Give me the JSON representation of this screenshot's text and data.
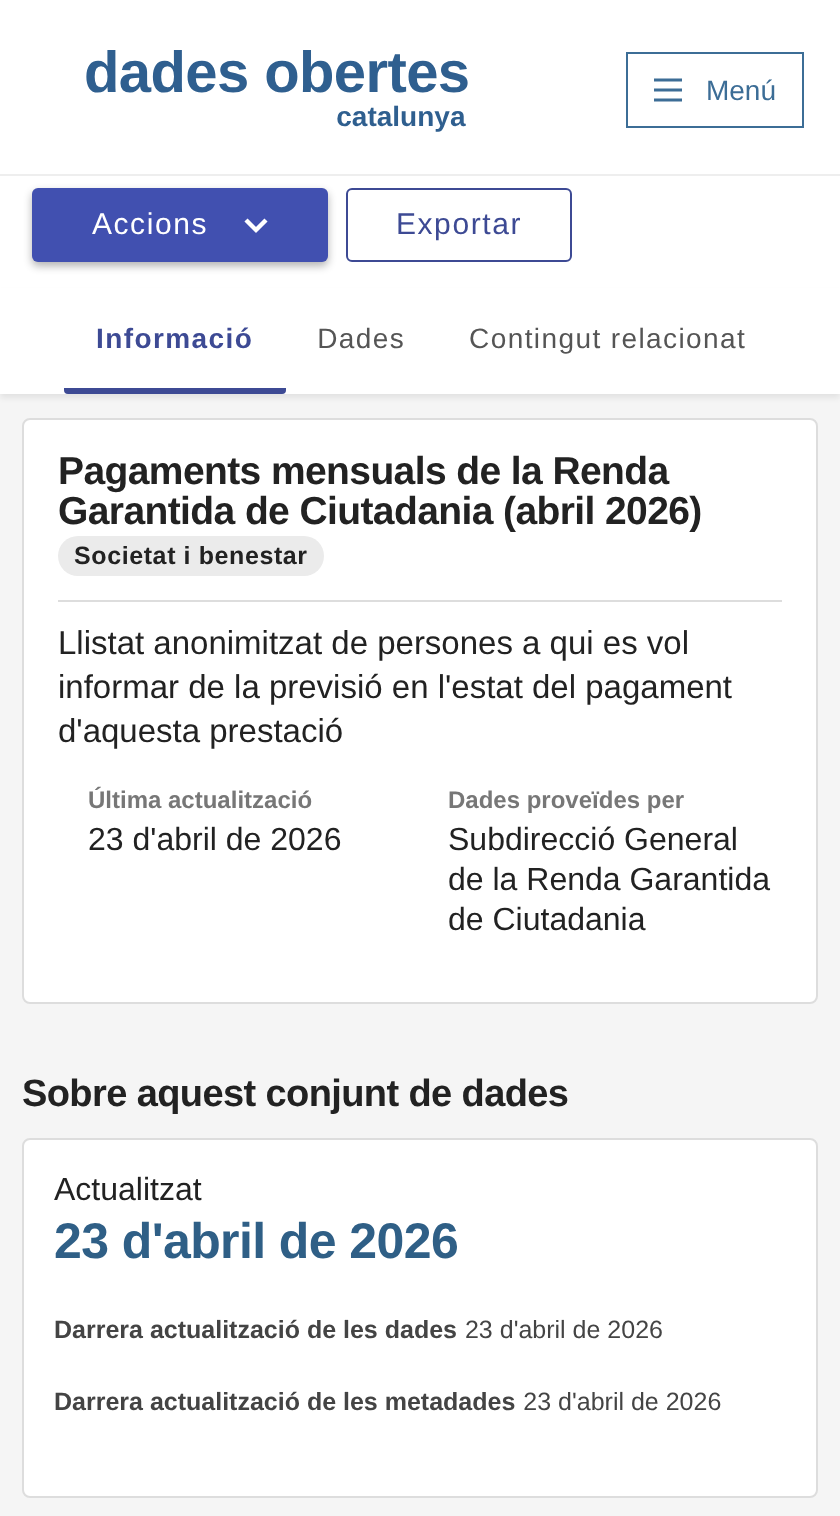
{
  "header": {
    "logo_title": "dades obertes",
    "logo_subtitle": "catalunya",
    "menu_button": "Menú"
  },
  "actions": {
    "primary": "Accions",
    "secondary": "Exportar"
  },
  "tabs": [
    {
      "label": "Informació",
      "selected": true
    },
    {
      "label": "Dades",
      "selected": false
    },
    {
      "label": "Contingut relacionat",
      "selected": false
    }
  ],
  "dataset": {
    "title": "Pagaments mensuals de la Renda Garantida de Ciutadania (abril 2026)",
    "category": "Societat i benestar",
    "description": "Llistat anonimitzat de persones a qui es vol informar de la previsió en l'estat del pagament d'aquesta prestació",
    "facts": [
      {
        "label": "Última actualització",
        "value": "23 d'abril de 2026"
      },
      {
        "label": "Dades proveïdes per",
        "value": "Subdirecció General de la Renda Garantida de Ciutadania"
      }
    ]
  },
  "about": {
    "heading": "Sobre aquest conjunt de dades",
    "updated_label": "Actualitzat",
    "updated_value": "23 d'abril de 2026",
    "rows": [
      {
        "label": "Darrera actualització de les dades",
        "value": "23 d'abril de 2026"
      },
      {
        "label": "Darrera actualització de les metadades",
        "value": "23 d'abril de 2026"
      }
    ]
  }
}
